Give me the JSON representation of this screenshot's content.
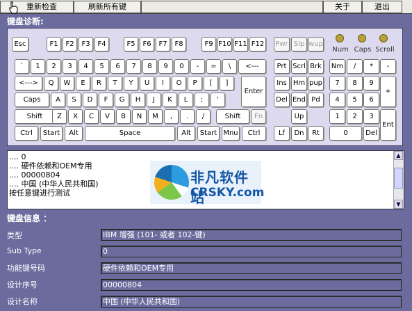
{
  "toolbar": {
    "recheck": "重新检查",
    "refresh_all": "刷新所有键",
    "about": "关于",
    "exit": "退出"
  },
  "sections": {
    "diagnostics": "键盘诊断:",
    "info": "键盘信息 ："
  },
  "leds": [
    {
      "label": "Num"
    },
    {
      "label": "Caps"
    },
    {
      "label": "Scroll"
    }
  ],
  "keys": {
    "esc": "Esc",
    "f1": "F1",
    "f2": "F2",
    "f3": "F3",
    "f4": "F4",
    "f5": "F5",
    "f6": "F6",
    "f7": "F7",
    "f8": "F8",
    "f9": "F9",
    "f10": "F10",
    "f11": "F11",
    "f12": "F12",
    "pwr": "Pwr",
    "slp": "Slp",
    "wup": "wup",
    "backtick": "`",
    "k1": "1",
    "k2": "2",
    "k3": "3",
    "k4": "4",
    "k5": "5",
    "k6": "6",
    "k7": "7",
    "k8": "8",
    "k9": "9",
    "k0": "0",
    "minus": "-",
    "equal": "=",
    "backslash": "\\",
    "backspace": "<---",
    "prt": "Prt",
    "scrl": "Scrl",
    "brk": "Brk",
    "nm": "Nm",
    "np_div": "/",
    "np_mul": "*",
    "np_sub": "-",
    "tab": "<--->",
    "q": "Q",
    "w": "W",
    "e": "E",
    "r": "R",
    "t": "T",
    "y": "Y",
    "u": "U",
    "i": "I",
    "o": "O",
    "p": "P",
    "lbracket": "[",
    "rbracket": "]",
    "enter": "Enter",
    "ins": "Ins",
    "hm": "Hm",
    "pup": "pup",
    "np7": "7",
    "np8": "8",
    "np9": "9",
    "np_add": "+",
    "caps": "Caps",
    "a": "A",
    "s": "S",
    "d": "D",
    "f": "F",
    "g": "G",
    "h": "H",
    "j": "J",
    "k": "K",
    "l": "L",
    "semicolon": ";",
    "quote": "'",
    "del": "Del",
    "end": "End",
    "pd": "Pd",
    "np4": "4",
    "np5": "5",
    "np6": "6",
    "lshift": "Shift",
    "z": "Z",
    "x": "X",
    "c": "C",
    "v": "V",
    "b": "B",
    "n": "N",
    "m": "M",
    "comma": ",",
    "period": ".",
    "slash": "/",
    "rshift": "Shift",
    "fn": "Fn",
    "up": "Up",
    "np1": "1",
    "np2": "2",
    "np3": "3",
    "np_enter": "Ent",
    "lctrl": "Ctrl",
    "lstart": "Start",
    "lalt": "Alt",
    "space": "Space",
    "ralt": "Alt",
    "rstart": "Start",
    "mnu": "Mnu",
    "rctrl": "Ctrl",
    "lf": "Lf",
    "dn": "Dn",
    "rt": "Rt",
    "np0": "0",
    "np_del": "Del"
  },
  "log": {
    "lines": [
      ".... 0",
      ".... 硬件依赖和OEM专用",
      ".... 00000804",
      ".... 中国 (中华人民共和国)",
      "按任意键进行测试"
    ]
  },
  "watermark": {
    "cn": "非凡软件站",
    "en": "CRSKY.com"
  },
  "info": {
    "rows": [
      {
        "label": "类型",
        "value": "IBM 增强 (101- 或者 102-键)"
      },
      {
        "label": "Sub Type",
        "value": "0"
      },
      {
        "label": "功能键号码",
        "value": "硬件依赖和OEM专用"
      },
      {
        "label": "设计序号",
        "value": "00000804"
      },
      {
        "label": "设计名称",
        "value": "中国 (中华人民共和国)"
      }
    ]
  }
}
